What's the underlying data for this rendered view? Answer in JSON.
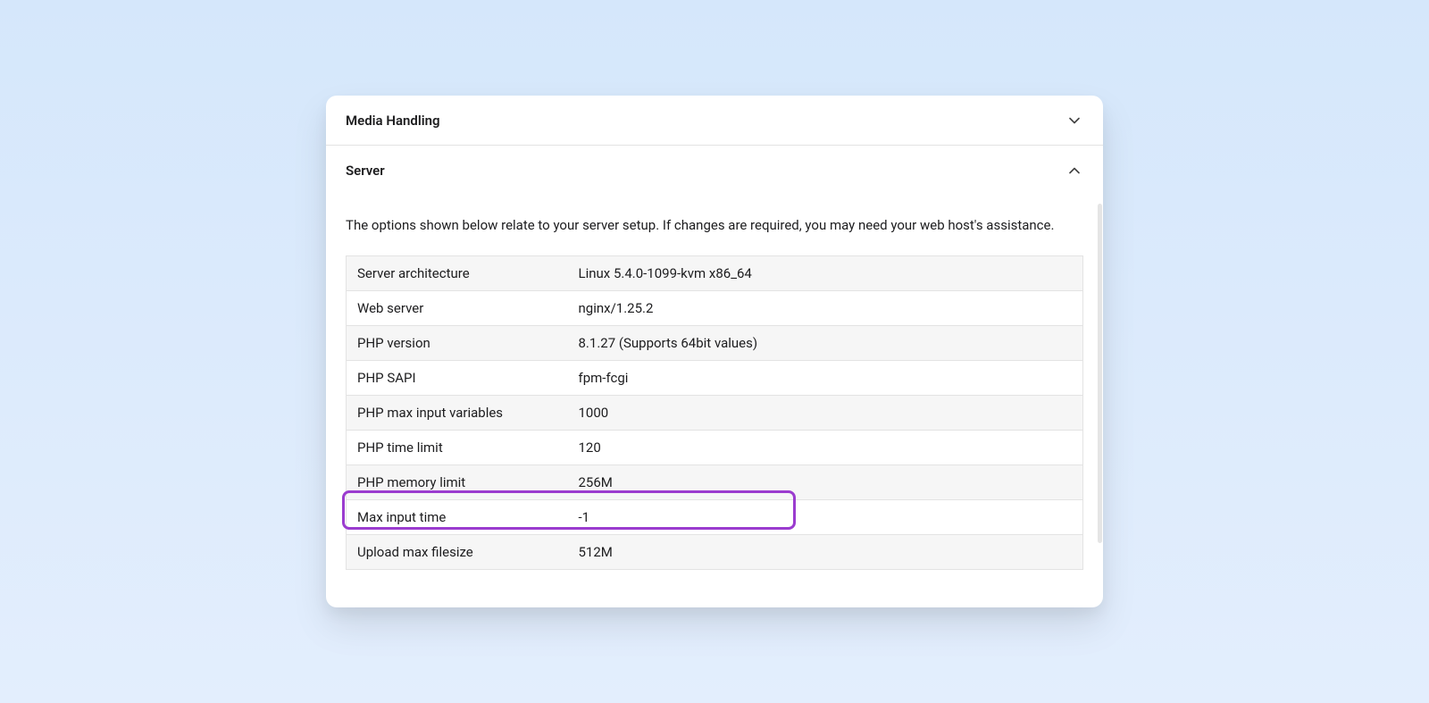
{
  "sections": {
    "media_handling": {
      "title": "Media Handling"
    },
    "server": {
      "title": "Server",
      "description": "The options shown below relate to your server setup. If changes are required, you may need your web host's assistance.",
      "rows": [
        {
          "label": "Server architecture",
          "value": "Linux 5.4.0-1099-kvm x86_64"
        },
        {
          "label": "Web server",
          "value": "nginx/1.25.2"
        },
        {
          "label": "PHP version",
          "value": "8.1.27 (Supports 64bit values)"
        },
        {
          "label": "PHP SAPI",
          "value": "fpm-fcgi"
        },
        {
          "label": "PHP max input variables",
          "value": "1000"
        },
        {
          "label": "PHP time limit",
          "value": "120"
        },
        {
          "label": "PHP memory limit",
          "value": "256M"
        },
        {
          "label": "Max input time",
          "value": "-1"
        },
        {
          "label": "Upload max filesize",
          "value": "512M"
        }
      ]
    }
  },
  "highlight_color": "#9b3ccf"
}
